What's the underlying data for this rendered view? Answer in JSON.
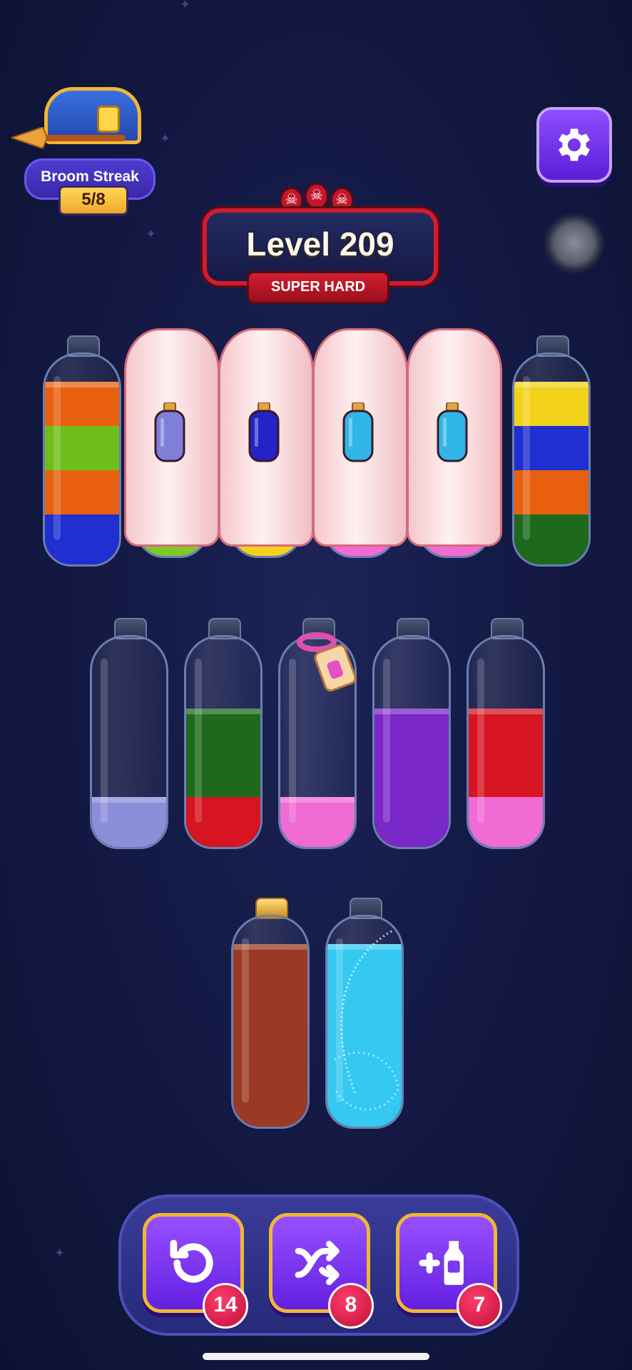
{
  "streak": {
    "label": "Broom Streak",
    "count": "5/8"
  },
  "level": {
    "title": "Level 209",
    "difficulty": "SUPER HARD"
  },
  "colors": {
    "orange": "#e8600f",
    "green": "#6fbf1a",
    "blue": "#1f2fd0",
    "yellow": "#f3d21a",
    "darkgreen": "#1d6a1d",
    "lavender": "#8c8ed8",
    "red": "#d61422",
    "pink": "#f06bd3",
    "purple": "#7a28c8",
    "brown": "#9a3a24",
    "cyan": "#35c9f2"
  },
  "board": {
    "row1": [
      {
        "type": "bottle",
        "layers": [
          "orange",
          "green",
          "orange",
          "blue"
        ]
      },
      {
        "type": "covered",
        "hint_color": "#7f7fd8",
        "base_color": "#7ec82a"
      },
      {
        "type": "covered",
        "hint_color": "#2323c6",
        "base_color": "#f3d21a"
      },
      {
        "type": "covered",
        "hint_color": "#2fb6e6",
        "base_color": "#f06bd3"
      },
      {
        "type": "covered",
        "hint_color": "#2fb6e6",
        "base_color": "#f06bd3"
      },
      {
        "type": "bottle",
        "layers": [
          "yellow",
          "blue",
          "orange",
          "darkgreen"
        ]
      }
    ],
    "row2": [
      {
        "type": "bottle",
        "layers": [
          "lavender"
        ]
      },
      {
        "type": "bottle",
        "layers": [
          "darkgreen",
          "darkgreen",
          "red"
        ]
      },
      {
        "type": "bottle",
        "layers": [
          "pink"
        ],
        "tag": "pink-potion-tag"
      },
      {
        "type": "bottle",
        "layers": [
          "purple",
          "purple",
          "purple"
        ]
      },
      {
        "type": "bottle",
        "layers": [
          "red",
          "red",
          "pink"
        ]
      }
    ],
    "row3": [
      {
        "type": "bottle",
        "layers": [
          "brown",
          "brown",
          "brown",
          "brown"
        ],
        "corked": true
      },
      {
        "type": "bottle",
        "layers": [
          "cyan",
          "cyan",
          "cyan",
          "cyan"
        ],
        "sparkle": true
      }
    ]
  },
  "tools": {
    "undo": {
      "icon": "undo-icon",
      "count": "14"
    },
    "shuffle": {
      "icon": "shuffle-icon",
      "count": "8"
    },
    "add_bottle": {
      "icon": "add-bottle-icon",
      "count": "7"
    }
  }
}
